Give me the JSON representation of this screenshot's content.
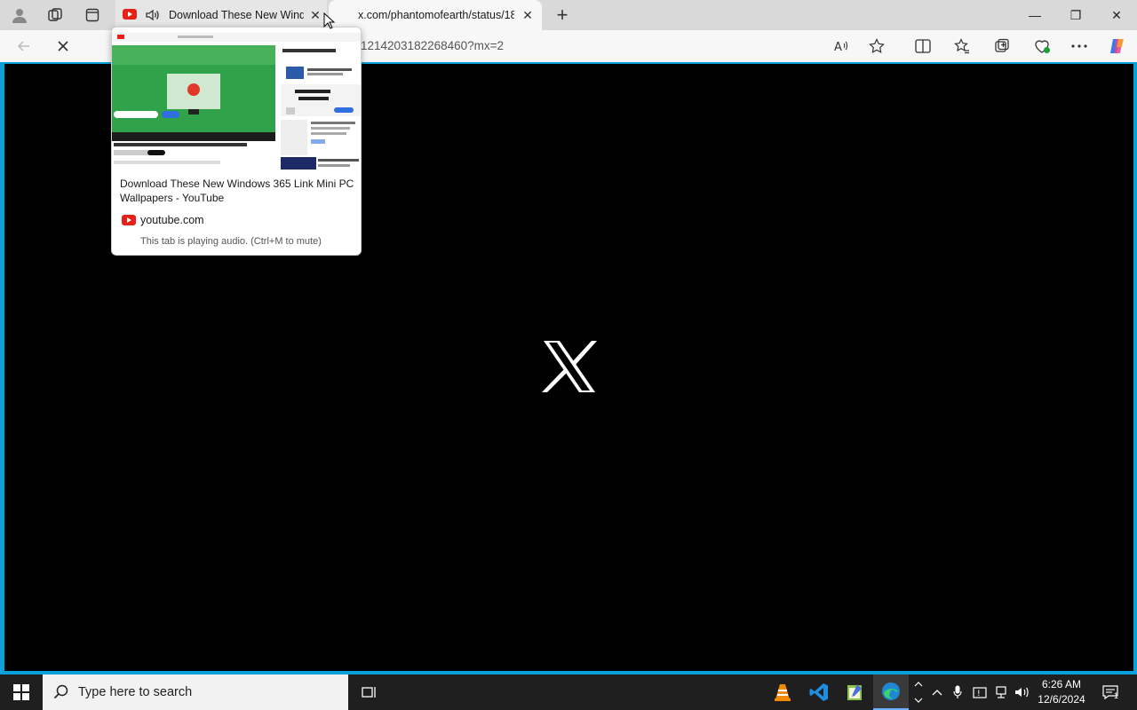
{
  "tabs": {
    "youtube": {
      "title": "Download These New Windo",
      "close": "✕"
    },
    "x": {
      "title": "x.com/phantomofearth/status/18",
      "close": "✕"
    },
    "new_tab": "+"
  },
  "window_controls": {
    "minimize": "—",
    "restore": "❐",
    "close": "✕"
  },
  "address": {
    "url": "1214203182268460?mx=2"
  },
  "hover_card": {
    "title": "Download These New Windows 365 Link Mini PC Wallpapers - YouTube",
    "site": "youtube.com",
    "audio_note": "This tab is playing audio. (Ctrl+M to mute)"
  },
  "taskbar": {
    "search_placeholder": "Type here to search",
    "time": "6:26 AM",
    "date": "12/6/2024",
    "notification_count": "1"
  },
  "colors": {
    "accent": "#0aa0dc",
    "youtube_red": "#e62117",
    "page_bg": "#000000"
  }
}
